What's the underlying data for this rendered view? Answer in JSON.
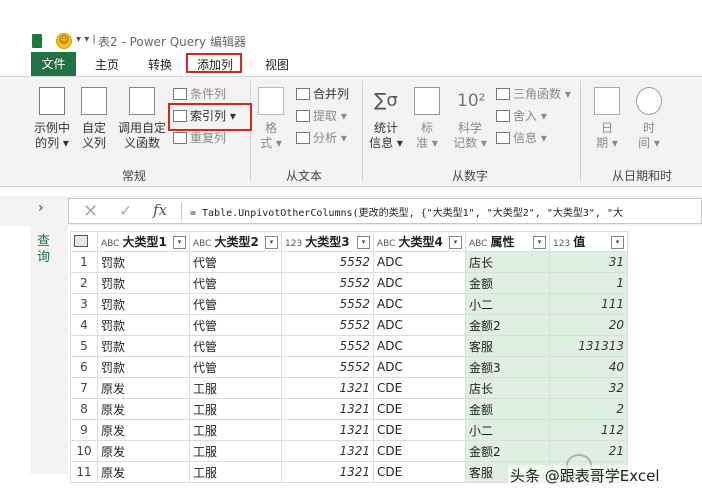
{
  "titlebar": {
    "title": "表2 - Power Query 编辑器",
    "quick_access": "▾ ▾ |"
  },
  "menu": {
    "items": [
      "文件",
      "主页",
      "转换",
      "添加列",
      "视图"
    ]
  },
  "ribbon": {
    "example_col": [
      "示例中",
      "的列 ▾"
    ],
    "custom_col": [
      "自定",
      "义列"
    ],
    "invoke_func": [
      "调用自定",
      "义函数"
    ],
    "conditional_col": "条件列",
    "index_col": "索引列 ▾",
    "duplicate_col": "重复列",
    "format": [
      "格",
      "式 ▾"
    ],
    "merge_cols": "合并列",
    "extract": "提取 ▾",
    "parse": "分析 ▾",
    "statistics": [
      "统计",
      "信息 ▾"
    ],
    "standard": [
      "标",
      "准 ▾"
    ],
    "scientific": [
      "科学",
      "记数 ▾"
    ],
    "trig": "三角函数 ▾",
    "rounding": "舍入 ▾",
    "information": "信息 ▾",
    "date": [
      "日",
      "期 ▾"
    ],
    "time": [
      "时",
      "间 ▾"
    ],
    "groups": {
      "general": "常规",
      "text": "从文本",
      "number": "从数字",
      "datetime": "从日期和时"
    }
  },
  "formula": {
    "text": "= Table.UnpivotOtherColumns(更改的类型, {\"大类型1\", \"大类型2\", \"大类型3\", \"大"
  },
  "query_pane": {
    "label": "查询"
  },
  "grid": {
    "columns": [
      {
        "type": "ABC",
        "name": "大类型1"
      },
      {
        "type": "ABC",
        "name": "大类型2"
      },
      {
        "type": "123",
        "name": "大类型3"
      },
      {
        "type": "ABC",
        "name": "大类型4"
      },
      {
        "type": "ABC",
        "name": "属性"
      },
      {
        "type": "123",
        "name": "值"
      }
    ],
    "rows": [
      [
        "1",
        "罚款",
        "代管",
        "5552",
        "ADC",
        "店长",
        "31"
      ],
      [
        "2",
        "罚款",
        "代管",
        "5552",
        "ADC",
        "金额",
        "1"
      ],
      [
        "3",
        "罚款",
        "代管",
        "5552",
        "ADC",
        "小二",
        "111"
      ],
      [
        "4",
        "罚款",
        "代管",
        "5552",
        "ADC",
        "金额2",
        "20"
      ],
      [
        "5",
        "罚款",
        "代管",
        "5552",
        "ADC",
        "客服",
        "131313"
      ],
      [
        "6",
        "罚款",
        "代管",
        "5552",
        "ADC",
        "金额3",
        "40"
      ],
      [
        "7",
        "原发",
        "工服",
        "1321",
        "CDE",
        "店长",
        "32"
      ],
      [
        "8",
        "原发",
        "工服",
        "1321",
        "CDE",
        "金额",
        "2"
      ],
      [
        "9",
        "原发",
        "工服",
        "1321",
        "CDE",
        "小二",
        "112"
      ],
      [
        "10",
        "原发",
        "工服",
        "1321",
        "CDE",
        "金额2",
        "21"
      ],
      [
        "11",
        "原发",
        "工服",
        "1321",
        "CDE",
        "客服",
        ""
      ]
    ]
  },
  "watermark": "头条 @跟表哥学Excel",
  "colors": {
    "accent": "#217346",
    "highlight": "#d7261c",
    "selected_col": "#dff0e3"
  }
}
